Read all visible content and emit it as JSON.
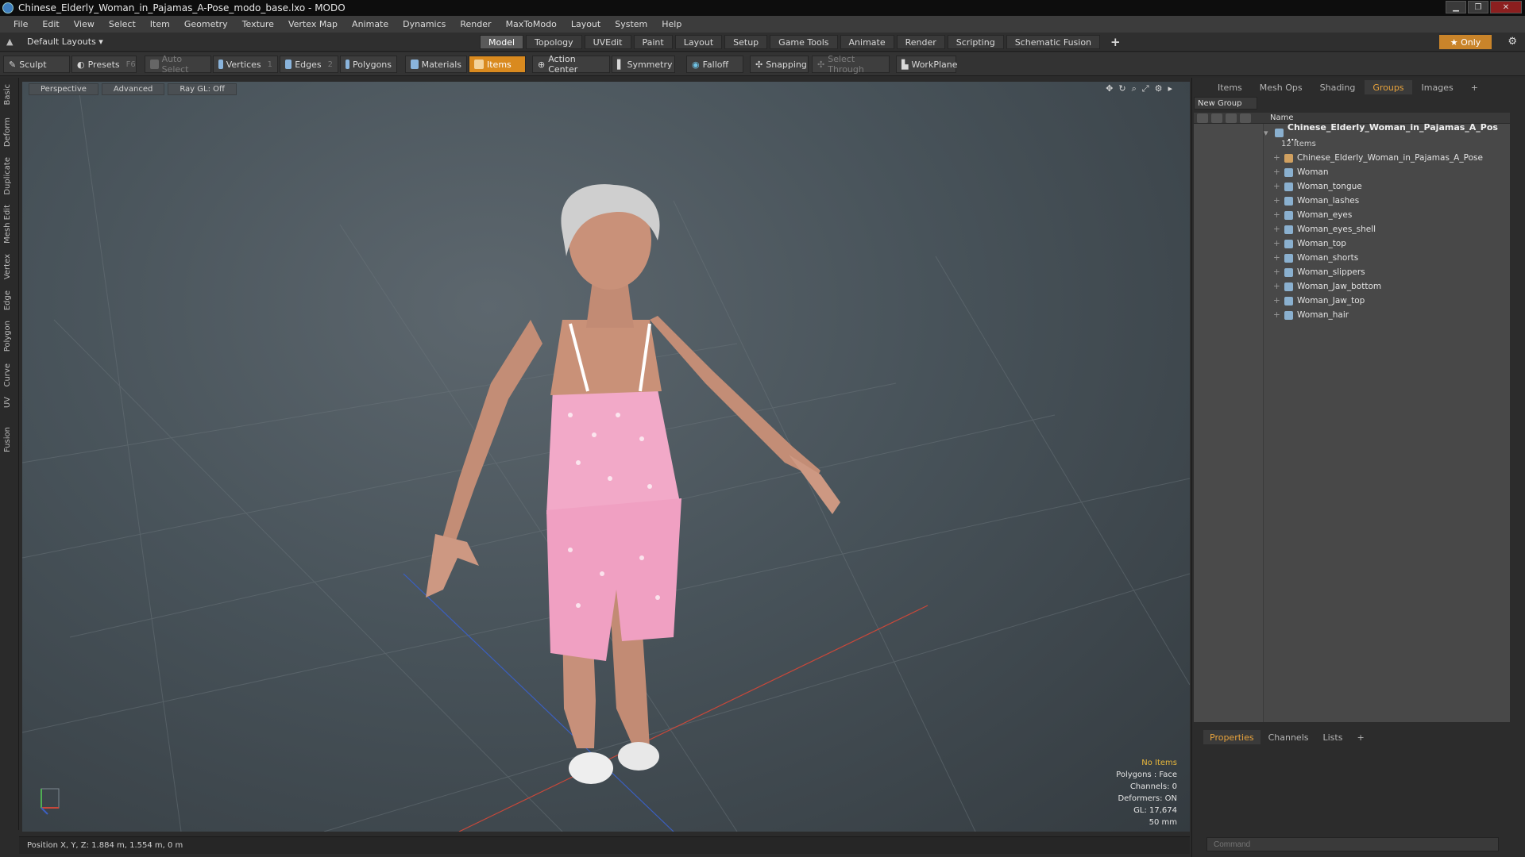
{
  "titlebar": {
    "title": "Chinese_Elderly_Woman_in_Pajamas_A-Pose_modo_base.lxo - MODO"
  },
  "menu": [
    "File",
    "Edit",
    "View",
    "Select",
    "Item",
    "Geometry",
    "Texture",
    "Vertex Map",
    "Animate",
    "Dynamics",
    "Render",
    "MaxToModo",
    "Layout",
    "System",
    "Help"
  ],
  "layoutbar": {
    "layouts_label": "Default Layouts ▾",
    "tabs": [
      "Model",
      "Topology",
      "UVEdit",
      "Paint",
      "Layout",
      "Setup",
      "Game Tools",
      "Animate",
      "Render",
      "Scripting",
      "Schematic Fusion"
    ],
    "active_tab": "Model",
    "plus": "+",
    "only_label": "★ Only"
  },
  "toolbar": {
    "sculpt": "Sculpt",
    "presets": "Presets",
    "presets_key": "F6",
    "auto_select": "Auto Select",
    "vertices": "Vertices",
    "vertices_key": "1",
    "edges": "Edges",
    "edges_key": "2",
    "polygons": "Polygons",
    "materials": "Materials",
    "items": "Items",
    "action_center": "Action Center",
    "symmetry": "Symmetry",
    "falloff": "Falloff",
    "snapping": "Snapping",
    "select_through": "Select Through",
    "workplane": "WorkPlane"
  },
  "left_tabs": [
    "Basic",
    "Deform",
    "Duplicate",
    "Mesh Edit",
    "Vertex",
    "Edge",
    "Polygon",
    "Curve",
    "UV",
    "Fusion"
  ],
  "viewport": {
    "view_mode": "Perspective",
    "advanced": "Advanced",
    "raygl": "Ray GL: Off",
    "info": {
      "selection": "No Items",
      "polygons": "Polygons : Face",
      "channels": "Channels: 0",
      "deformers": "Deformers: ON",
      "gl": "GL: 17,674",
      "lens": "50 mm"
    },
    "grid_color": "#6b757b",
    "x_axis_color": "#c8483a",
    "z_axis_color": "#3b5fc0"
  },
  "status": {
    "position": "Position X, Y, Z:  1.884 m, 1.554 m, 0 m"
  },
  "right_panel": {
    "tabs": [
      "Items",
      "Mesh Ops",
      "Shading",
      "Groups",
      "Images",
      "+"
    ],
    "active_tab": "Groups",
    "new_group": "New Group",
    "column_name": "Name",
    "group_name": "Chinese_Elderly_Woman_in_Pajamas_A_Pos ...",
    "group_count": "12 Items",
    "items": [
      "Chinese_Elderly_Woman_in_Pajamas_A_Pose",
      "Woman",
      "Woman_tongue",
      "Woman_lashes",
      "Woman_eyes",
      "Woman_eyes_shell",
      "Woman_top",
      "Woman_shorts",
      "Woman_slippers",
      "Woman_Jaw_bottom",
      "Woman_Jaw_top",
      "Woman_hair"
    ],
    "props_tabs": [
      "Properties",
      "Channels",
      "Lists",
      "+"
    ],
    "command_placeholder": "Command"
  }
}
